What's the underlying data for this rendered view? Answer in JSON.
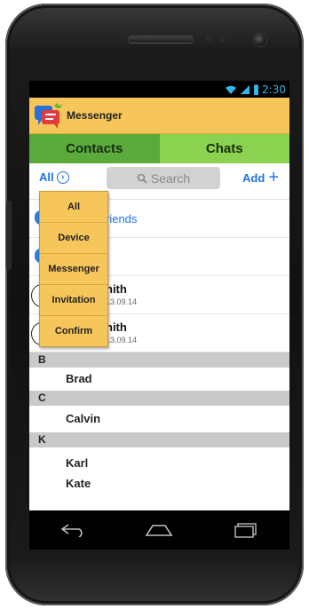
{
  "status_bar": {
    "time": "2:30"
  },
  "app": {
    "title": "Messenger"
  },
  "tabs": [
    {
      "label": "Contacts"
    },
    {
      "label": "Chats"
    }
  ],
  "toolbar": {
    "filter_label": "All",
    "search_placeholder": "Search",
    "add_label": "Add"
  },
  "dropdown": {
    "items": [
      "All",
      "Device",
      "Messenger",
      "Invitation",
      "Confirm"
    ]
  },
  "rows": [
    {
      "text": "riends"
    },
    {
      "text": ""
    },
    {
      "name": "nith",
      "date": "13.09.14"
    },
    {
      "name": "nith",
      "date": "13.09.14"
    }
  ],
  "sections": [
    {
      "letter": "B",
      "contacts": [
        "Brad"
      ]
    },
    {
      "letter": "C",
      "contacts": [
        "Calvin"
      ]
    },
    {
      "letter": "K",
      "contacts": [
        "Karl",
        "Kate"
      ]
    }
  ],
  "colors": {
    "app_bar": "#f7c65b",
    "tab_contacts": "#5aaa3c",
    "tab_chats": "#8ad24f",
    "accent": "#1e73e8"
  },
  "icons": {
    "status": [
      "wifi-icon",
      "signal-icon",
      "battery-icon"
    ],
    "nav": [
      "back-icon",
      "home-icon",
      "recents-icon"
    ]
  }
}
